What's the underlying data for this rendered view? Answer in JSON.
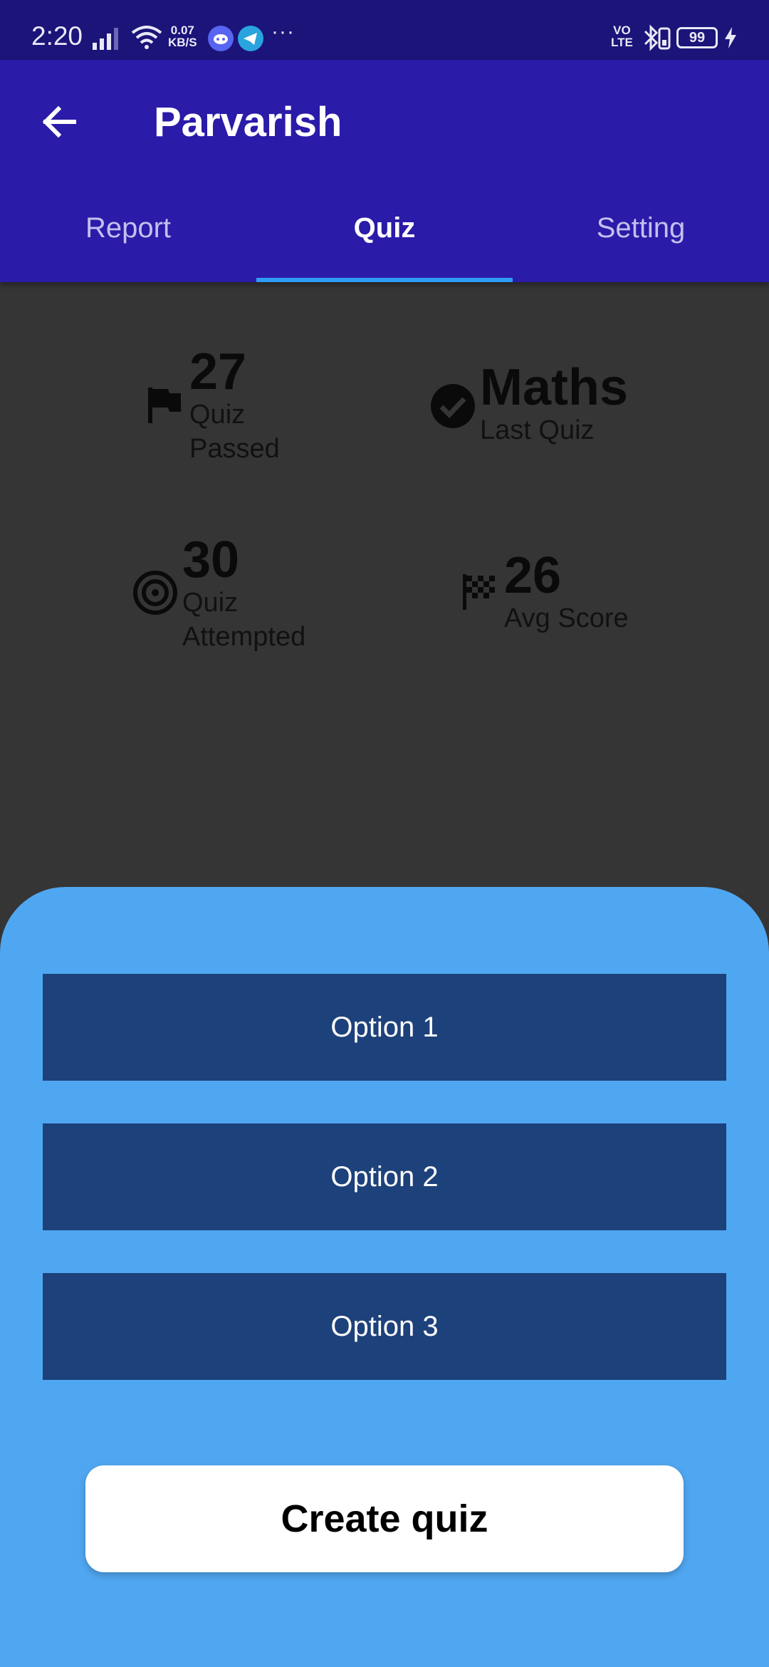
{
  "status_bar": {
    "time": "2:20",
    "net_speed_value": "0.07",
    "net_speed_unit": "KB/S",
    "more": "···",
    "volte_top": "VO",
    "volte_bottom": "LTE",
    "battery": "99",
    "icons": [
      "signal-icon",
      "wifi-icon",
      "discord-icon",
      "telegram-icon",
      "bluetooth-icon",
      "battery-icon",
      "charging-icon"
    ]
  },
  "app_bar": {
    "title": "Parvarish",
    "back_icon": "arrow-left-icon",
    "background": "#2a1ba8"
  },
  "tabs": [
    {
      "label": "Report",
      "active": false
    },
    {
      "label": "Quiz",
      "active": true
    },
    {
      "label": "Setting",
      "active": false
    }
  ],
  "stats": {
    "quiz_passed": {
      "value": "27",
      "label_line1": "Quiz",
      "label_line2": "Passed",
      "icon": "flag-icon"
    },
    "last_quiz": {
      "value": "Maths",
      "label": "Last Quiz",
      "icon": "check-circle-icon"
    },
    "quiz_attempted": {
      "value": "30",
      "label_line1": "Quiz",
      "label_line2": "Attempted",
      "icon": "target-icon"
    },
    "avg_score": {
      "value": "26",
      "label": "Avg Score",
      "icon": "checkered-flag-icon"
    }
  },
  "sheet": {
    "background": "#50a7f1",
    "options": [
      {
        "label": "Option 1"
      },
      {
        "label": "Option 2"
      },
      {
        "label": "Option 3"
      }
    ],
    "create_button": "Create quiz"
  },
  "colors": {
    "status_bar": "#1b1479",
    "body_background": "#353535",
    "tab_indicator": "#2f9df4",
    "option_button": "#1d417b"
  }
}
